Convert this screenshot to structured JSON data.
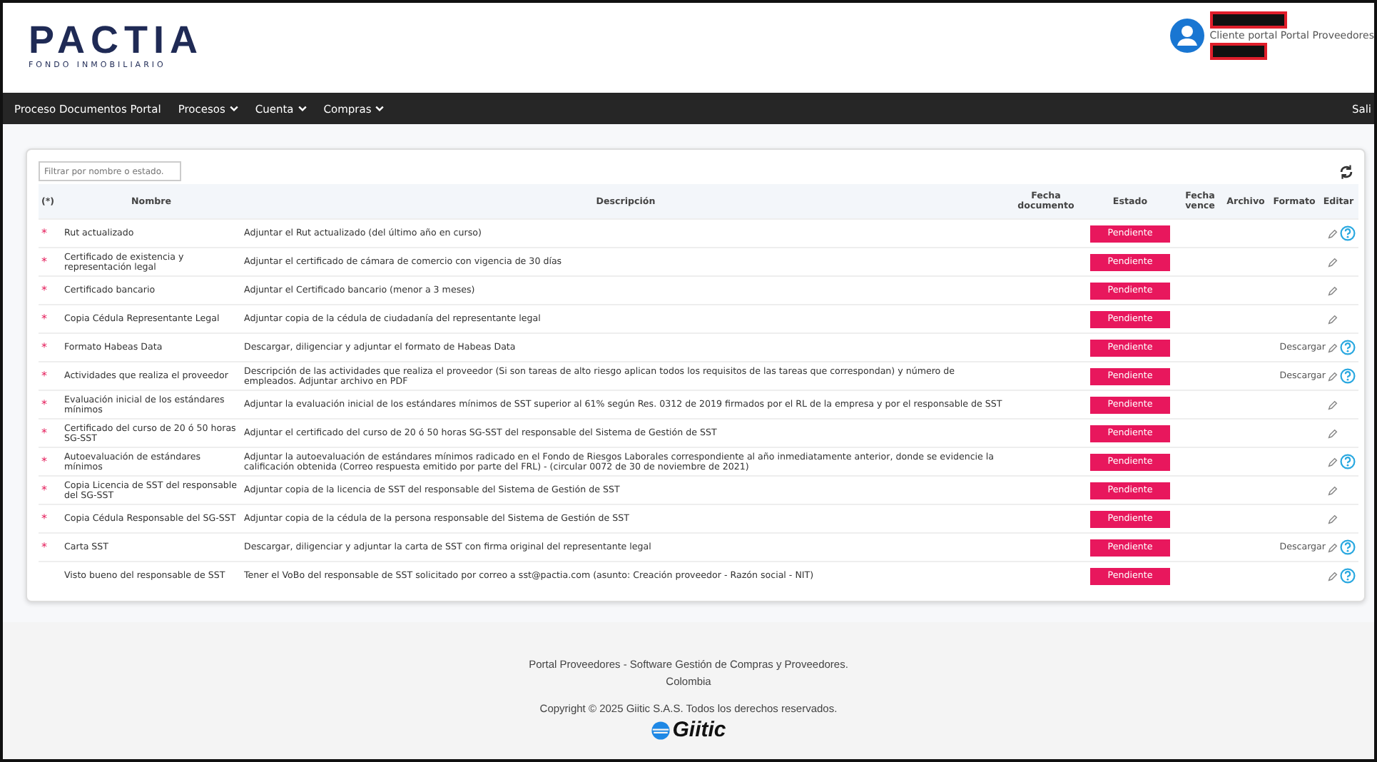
{
  "header": {
    "logo": {
      "name": "PACTIA",
      "tagline": "FONDO INMOBILIARIO"
    },
    "user": {
      "role": "Cliente portal Portal Proveedores"
    }
  },
  "nav": {
    "items": [
      {
        "label": "Proceso Documentos Portal",
        "dropdown": false
      },
      {
        "label": "Procesos",
        "dropdown": true
      },
      {
        "label": "Cuenta",
        "dropdown": true
      },
      {
        "label": "Compras",
        "dropdown": true
      }
    ],
    "logout": "Sali"
  },
  "filter": {
    "placeholder": "Filtrar por nombre o estado."
  },
  "table": {
    "columns": [
      "(*)",
      "Nombre",
      "Descripción",
      "Fecha documento",
      "Estado",
      "Fecha vence",
      "Archivo",
      "Formato",
      "Editar"
    ],
    "rows": [
      {
        "mark": "*",
        "name": "Rut actualizado",
        "description": "Adjuntar el Rut actualizado (del último año en curso)",
        "status": "Pendiente",
        "format": null,
        "help": true
      },
      {
        "mark": "*",
        "name": "Certificado de existencia y representación legal",
        "description": "Adjuntar el certificado de cámara de comercio con vigencia de 30 días",
        "status": "Pendiente",
        "format": null,
        "help": false
      },
      {
        "mark": "*",
        "name": "Certificado bancario",
        "description": "Adjuntar el Certificado bancario (menor a 3 meses)",
        "status": "Pendiente",
        "format": null,
        "help": false
      },
      {
        "mark": "*",
        "name": "Copia Cédula Representante Legal",
        "description": "Adjuntar copia de la cédula de ciudadanía del representante legal",
        "status": "Pendiente",
        "format": null,
        "help": false
      },
      {
        "mark": "*",
        "name": "Formato Habeas Data",
        "description": "Descargar, diligenciar y adjuntar el formato de Habeas Data",
        "status": "Pendiente",
        "format": "Descargar",
        "help": true
      },
      {
        "mark": "*",
        "name": "Actividades que realiza el proveedor",
        "description": "Descripción de las actividades que realiza el proveedor (Si son tareas de alto riesgo aplican todos los requisitos de las tareas que correspondan) y número de empleados. Adjuntar archivo en PDF",
        "status": "Pendiente",
        "format": "Descargar",
        "help": true
      },
      {
        "mark": "*",
        "name": "Evaluación inicial de los estándares mínimos",
        "description": "Adjuntar la evaluación inicial de los estándares mínimos de SST superior al 61% según Res. 0312 de 2019 firmados por el RL de la empresa y por el responsable de SST",
        "status": "Pendiente",
        "format": null,
        "help": false
      },
      {
        "mark": "*",
        "name": "Certificado del curso de 20 ó 50 horas SG-SST",
        "description": "Adjuntar el certificado del curso de 20 ó 50 horas SG-SST del responsable del Sistema de Gestión de SST",
        "status": "Pendiente",
        "format": null,
        "help": false
      },
      {
        "mark": "*",
        "name": "Autoevaluación de estándares mínimos",
        "description": "Adjuntar la autoevaluación de estándares mínimos radicado en el Fondo de Riesgos Laborales correspondiente al año inmediatamente anterior, donde se evidencie la calificación obtenida (Correo respuesta emitido por parte del FRL) - (circular 0072 de 30 de noviembre de 2021)",
        "status": "Pendiente",
        "format": null,
        "help": true
      },
      {
        "mark": "*",
        "name": "Copia Licencia de SST del responsable del SG-SST",
        "description": "Adjuntar copia de la licencia de SST del responsable del Sistema de Gestión de SST",
        "status": "Pendiente",
        "format": null,
        "help": false
      },
      {
        "mark": "*",
        "name": "Copia Cédula Responsable del SG-SST",
        "description": "Adjuntar copia de la cédula de la persona responsable del Sistema de Gestión de SST",
        "status": "Pendiente",
        "format": null,
        "help": false
      },
      {
        "mark": "*",
        "name": "Carta SST",
        "description": "Descargar, diligenciar y adjuntar la carta de SST con firma original del representante legal",
        "status": "Pendiente",
        "format": "Descargar",
        "help": true
      },
      {
        "name": "Visto bueno del responsable de SST",
        "description": "Tener el VoBo del responsable de SST solicitado por correo a sst@pactia.com (asunto: Creación proveedor - Razón social - NIT)",
        "status": "Pendiente",
        "format": null,
        "help": true
      }
    ]
  },
  "footer": {
    "lines": [
      "Portal Proveedores  - Software Gestión de Compras y Proveedores.",
      "Colombia",
      "Copyright © 2025 Giitic S.A.S. Todos los derechos reservados."
    ],
    "brand": "Giitic"
  }
}
